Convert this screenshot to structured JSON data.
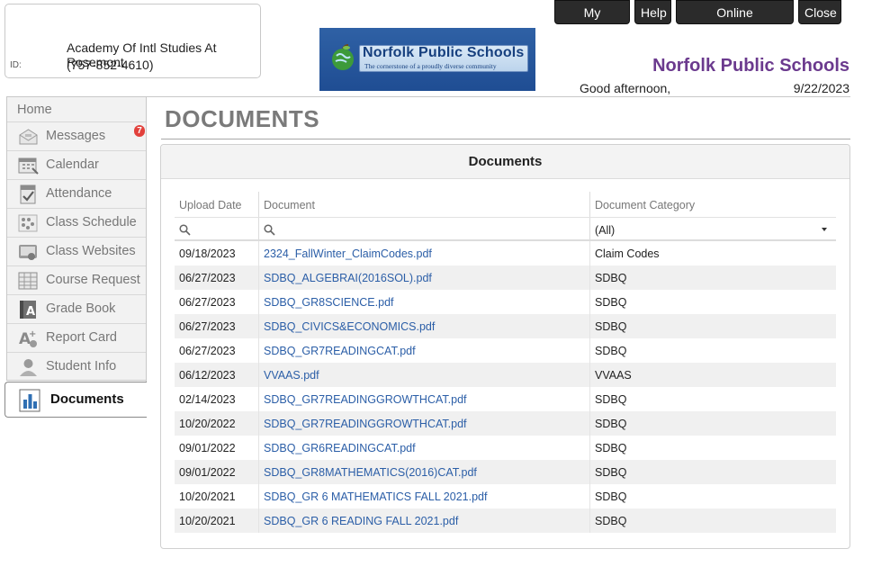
{
  "student": {
    "school": "Academy Of Intl Studies At Rosemont",
    "phone": "(757-852-4610)",
    "id_label": "ID:"
  },
  "logo": {
    "title": "Norfolk Public Schools",
    "tagline": "The cornerstone of a proudly diverse community"
  },
  "topnav": {
    "my_account": "My Account",
    "help": "Help",
    "online_registration": "Online Registration",
    "close": "Close"
  },
  "header": {
    "district": "Norfolk Public Schools",
    "greeting": "Good afternoon,",
    "date": "9/22/2023"
  },
  "sidebar": {
    "home": "Home",
    "messages_badge": "7",
    "items": [
      {
        "label": "Messages",
        "icon": "envelope-icon"
      },
      {
        "label": "Calendar",
        "icon": "calendar-icon"
      },
      {
        "label": "Attendance",
        "icon": "attendance-icon"
      },
      {
        "label": "Class Schedule",
        "icon": "schedule-icon"
      },
      {
        "label": "Class Websites",
        "icon": "websites-icon"
      },
      {
        "label": "Course Request",
        "icon": "course-request-icon"
      },
      {
        "label": "Grade Book",
        "icon": "gradebook-icon"
      },
      {
        "label": "Report Card",
        "icon": "report-card-icon"
      },
      {
        "label": "Student Info",
        "icon": "student-info-icon"
      }
    ],
    "active": {
      "label": "Documents",
      "icon": "documents-icon"
    }
  },
  "page": {
    "title": "DOCUMENTS",
    "panel_title": "Documents"
  },
  "grid": {
    "columns": [
      "Upload Date",
      "Document",
      "Document Category"
    ],
    "category_filter": "(All)",
    "rows": [
      {
        "date": "09/18/2023",
        "document": "2324_FallWinter_ClaimCodes.pdf",
        "category": "Claim Codes"
      },
      {
        "date": "06/27/2023",
        "document": "SDBQ_ALGEBRAI(2016SOL).pdf",
        "category": "SDBQ"
      },
      {
        "date": "06/27/2023",
        "document": "SDBQ_GR8SCIENCE.pdf",
        "category": "SDBQ"
      },
      {
        "date": "06/27/2023",
        "document": "SDBQ_CIVICS&ECONOMICS.pdf",
        "category": "SDBQ"
      },
      {
        "date": "06/27/2023",
        "document": "SDBQ_GR7READINGCAT.pdf",
        "category": "SDBQ"
      },
      {
        "date": "06/12/2023",
        "document": "VVAAS.pdf",
        "category": "VVAAS"
      },
      {
        "date": "02/14/2023",
        "document": "SDBQ_GR7READINGGROWTHCAT.pdf",
        "category": "SDBQ"
      },
      {
        "date": "10/20/2022",
        "document": "SDBQ_GR7READINGGROWTHCAT.pdf",
        "category": "SDBQ"
      },
      {
        "date": "09/01/2022",
        "document": "SDBQ_GR6READINGCAT.pdf",
        "category": "SDBQ"
      },
      {
        "date": "09/01/2022",
        "document": "SDBQ_GR8MATHEMATICS(2016)CAT.pdf",
        "category": "SDBQ"
      },
      {
        "date": "10/20/2021",
        "document": "SDBQ_GR 6 MATHEMATICS FALL 2021.pdf",
        "category": "SDBQ"
      },
      {
        "date": "10/20/2021",
        "document": "SDBQ_GR 6 READING FALL 2021.pdf",
        "category": "SDBQ"
      }
    ]
  }
}
